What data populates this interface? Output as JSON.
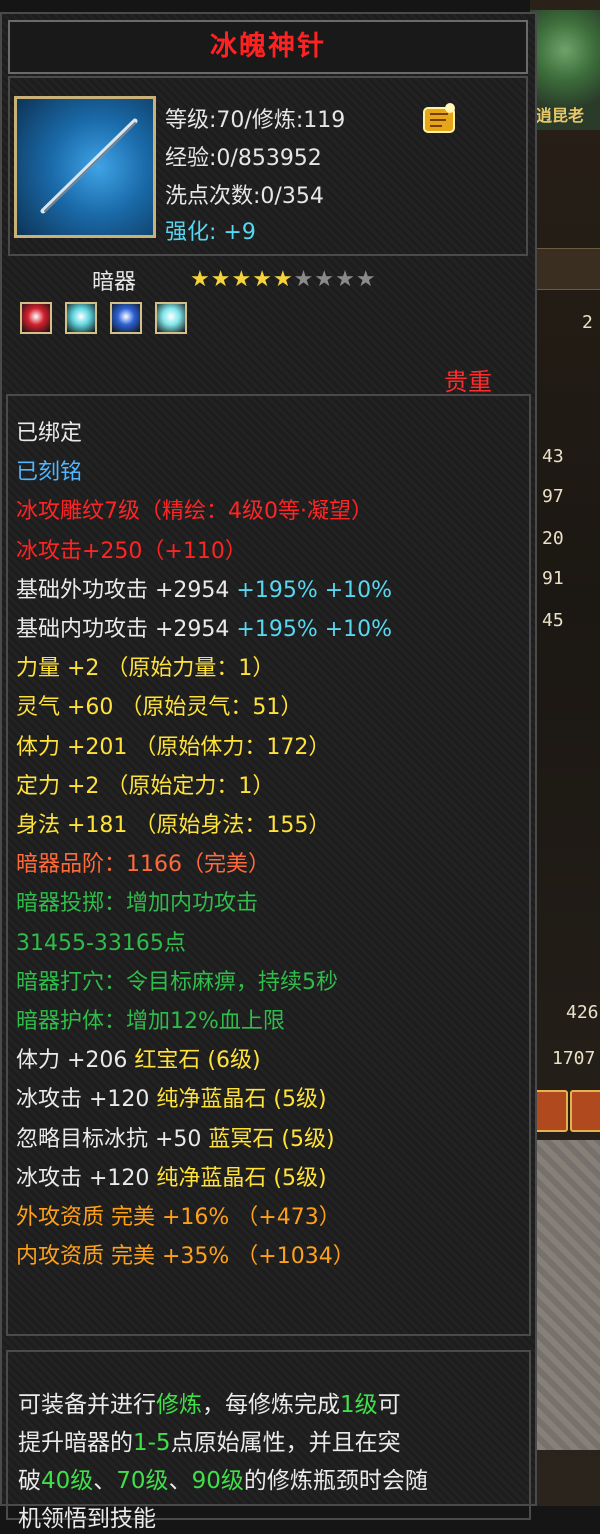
{
  "window": {
    "title": "冰魄神针"
  },
  "header": {
    "level_line": "等级:70/修炼:119",
    "exp_line": "经验:0/853952",
    "wash_line": "洗点次数:0/354",
    "enhance_label": "强化:",
    "enhance_value": "+9",
    "item_icon": "needle-weapon-icon",
    "badge_icon": "golden-scroll-icon"
  },
  "meta": {
    "type": "暗器",
    "stars_filled": 5,
    "stars_total": 9,
    "precious": "贵重",
    "gems": [
      {
        "name": "red-gem-icon",
        "color": "#d3202e"
      },
      {
        "name": "cyan-gem-icon",
        "color": "#5fd6e0"
      },
      {
        "name": "blue-gem-icon",
        "color": "#2b62d6"
      },
      {
        "name": "cyan-gem-icon",
        "color": "#7fe6ea"
      }
    ]
  },
  "attributes": [
    {
      "segments": [
        {
          "t": "已绑定",
          "c": "white"
        }
      ]
    },
    {
      "segments": [
        {
          "t": "已刻铭",
          "c": "blue"
        }
      ]
    },
    {
      "segments": [
        {
          "t": "冰攻雕纹7级（精绘：4级0等·凝望）",
          "c": "red"
        }
      ]
    },
    {
      "segments": [
        {
          "t": "冰攻击+250（+110）",
          "c": "red"
        }
      ]
    },
    {
      "segments": [
        {
          "t": "基础外功攻击 +2954 ",
          "c": "white"
        },
        {
          "t": "+195% +10%",
          "c": "cyan"
        }
      ]
    },
    {
      "segments": [
        {
          "t": "基础内功攻击 +2954 ",
          "c": "white"
        },
        {
          "t": "+195% +10%",
          "c": "cyan"
        }
      ]
    },
    {
      "segments": [
        {
          "t": "力量 +2 （原始力量：1）",
          "c": "yellow"
        }
      ]
    },
    {
      "segments": [
        {
          "t": "灵气 +60 （原始灵气：51）",
          "c": "yellow"
        }
      ]
    },
    {
      "segments": [
        {
          "t": "体力 +201 （原始体力：172）",
          "c": "yellow"
        }
      ]
    },
    {
      "segments": [
        {
          "t": "定力 +2 （原始定力：1）",
          "c": "yellow"
        }
      ]
    },
    {
      "segments": [
        {
          "t": "身法 +181 （原始身法：155）",
          "c": "yellow"
        }
      ]
    },
    {
      "segments": [
        {
          "t": "暗器品阶：1166（完美）",
          "c": "orange"
        }
      ]
    },
    {
      "segments": [
        {
          "t": "暗器投掷：增加内功攻击",
          "c": "green"
        }
      ]
    },
    {
      "segments": [
        {
          "t": "31455-33165点",
          "c": "green"
        }
      ]
    },
    {
      "segments": [
        {
          "t": "暗器打穴：令目标麻痹，持续5秒",
          "c": "green"
        }
      ]
    },
    {
      "segments": [
        {
          "t": "暗器护体：增加12%血上限",
          "c": "green"
        }
      ]
    },
    {
      "segments": [
        {
          "t": "体力 +206 ",
          "c": "white"
        },
        {
          "t": "红宝石 (6级)",
          "c": "yellow"
        }
      ]
    },
    {
      "segments": [
        {
          "t": "冰攻击 +120 ",
          "c": "white"
        },
        {
          "t": "纯净蓝晶石 (5级)",
          "c": "yellow"
        }
      ]
    },
    {
      "segments": [
        {
          "t": "忽略目标冰抗 +50 ",
          "c": "white"
        },
        {
          "t": "蓝冥石 (5级)",
          "c": "yellow"
        }
      ]
    },
    {
      "segments": [
        {
          "t": "冰攻击 +120 ",
          "c": "white"
        },
        {
          "t": "纯净蓝晶石 (5级)",
          "c": "yellow"
        }
      ]
    },
    {
      "segments": [
        {
          "t": "外攻资质 完美 +16% （+473）",
          "c": "gold"
        }
      ]
    },
    {
      "segments": [
        {
          "t": "内攻资质 完美 +35% （+1034）",
          "c": "gold"
        }
      ]
    }
  ],
  "description": [
    [
      {
        "t": "可装备并进行",
        "h": false
      },
      {
        "t": "修炼",
        "h": true
      },
      {
        "t": "，每修炼完成",
        "h": false
      },
      {
        "t": "1级",
        "h": true
      },
      {
        "t": "可",
        "h": false
      }
    ],
    [
      {
        "t": "提升暗器的",
        "h": false
      },
      {
        "t": "1-5",
        "h": true
      },
      {
        "t": "点原始属性，并且在突",
        "h": false
      }
    ],
    [
      {
        "t": "破",
        "h": false
      },
      {
        "t": "40级",
        "h": true
      },
      {
        "t": "、",
        "h": false
      },
      {
        "t": "70级",
        "h": true
      },
      {
        "t": "、",
        "h": false
      },
      {
        "t": "90级",
        "h": true
      },
      {
        "t": "的修炼瓶颈时会随",
        "h": false
      }
    ],
    [
      {
        "t": "机领悟到技能",
        "h": false
      }
    ]
  ],
  "background": {
    "art_text": "逍昆老",
    "values": [
      "43",
      "97",
      "20",
      "91",
      "45"
    ],
    "bottom_values": [
      "426",
      "1707"
    ],
    "mid_value": "2"
  }
}
